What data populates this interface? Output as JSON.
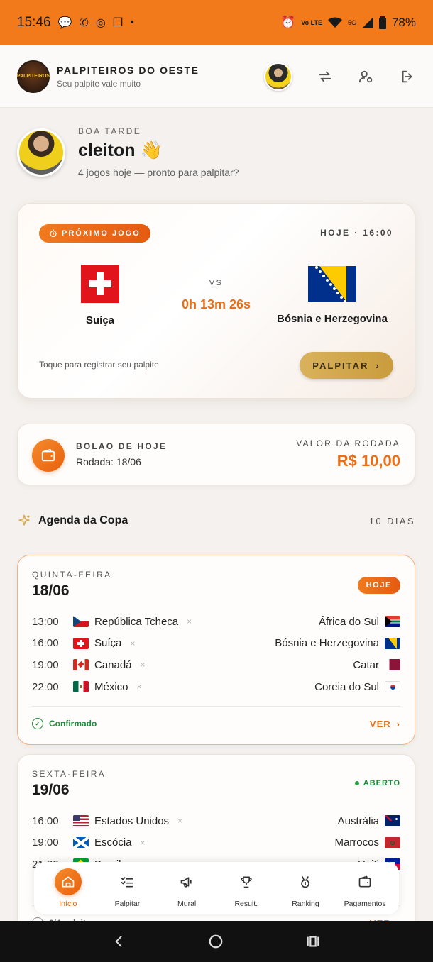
{
  "status_bar": {
    "time": "15:46",
    "battery": "78%",
    "network": "5G",
    "volte": "Vo LTE"
  },
  "header": {
    "brand_title": "PALPITEIROS DO OESTE",
    "brand_subtitle": "Seu palpite vale muito",
    "logo_text": "PALPITEIROS"
  },
  "greeting": {
    "kicker": "BOA TARDE",
    "name": "cleiton 👋",
    "subtitle": "4 jogos hoje — pronto para palpitar?"
  },
  "next_match": {
    "label": "PRÓXIMO JOGO",
    "when": "HOJE · 16:00",
    "home_team": "Suíça",
    "away_team": "Bósnia e Herzegovina",
    "vs": "VS",
    "countdown": "0h 13m 26s",
    "hint": "Toque para registrar seu palpite",
    "button": "PALPITAR"
  },
  "pool": {
    "kicker": "BOLAO DE HOJE",
    "round_label": "Rodada: 18/06",
    "value_label": "VALOR DA RODADA",
    "value": "R$ 10,00"
  },
  "agenda": {
    "title": "Agenda da Copa",
    "days_label": "10 DIAS",
    "days": [
      {
        "weekday": "QUINTA-FEIRA",
        "date": "18/06",
        "badge": "HOJE",
        "matches": [
          {
            "time": "13:00",
            "home": "República Tcheca",
            "away": "África do Sul",
            "home_flag": "cz",
            "away_flag": "za"
          },
          {
            "time": "16:00",
            "home": "Suíça",
            "away": "Bósnia e Herzegovina",
            "home_flag": "ch",
            "away_flag": "ba"
          },
          {
            "time": "19:00",
            "home": "Canadá",
            "away": "Catar",
            "home_flag": "ca",
            "away_flag": "qa"
          },
          {
            "time": "22:00",
            "home": "México",
            "away": "Coreia do Sul",
            "home_flag": "mx",
            "away_flag": "kr"
          }
        ],
        "footer_status": "Confirmado",
        "footer_action": "VER"
      },
      {
        "weekday": "SEXTA-FEIRA",
        "date": "19/06",
        "badge": "ABERTO",
        "matches": [
          {
            "time": "16:00",
            "home": "Estados Unidos",
            "away": "Austrália",
            "home_flag": "us",
            "away_flag": "au"
          },
          {
            "time": "19:00",
            "home": "Escócia",
            "away": "Marrocos",
            "home_flag": "sc",
            "away_flag": "ma"
          },
          {
            "time": "21:30",
            "home": "Brasil",
            "away": "Haiti",
            "home_flag": "br",
            "away_flag": "ht"
          }
        ],
        "footer_status": "0/4 palpites",
        "footer_action": "VER"
      }
    ]
  },
  "bottom_nav": {
    "items": [
      {
        "label": "Início",
        "icon": "home-icon",
        "active": true
      },
      {
        "label": "Palpitar",
        "icon": "checklist-icon",
        "active": false
      },
      {
        "label": "Mural",
        "icon": "megaphone-icon",
        "active": false
      },
      {
        "label": "Result.",
        "icon": "trophy-icon",
        "active": false
      },
      {
        "label": "Ranking",
        "icon": "medal-icon",
        "active": false
      },
      {
        "label": "Pagamentos",
        "icon": "wallet-icon",
        "active": false
      }
    ]
  },
  "colors": {
    "accent": "#ea6f17",
    "status_bar": "#f27a1a",
    "gold": "#d4aa55",
    "success": "#1f8a3a"
  }
}
